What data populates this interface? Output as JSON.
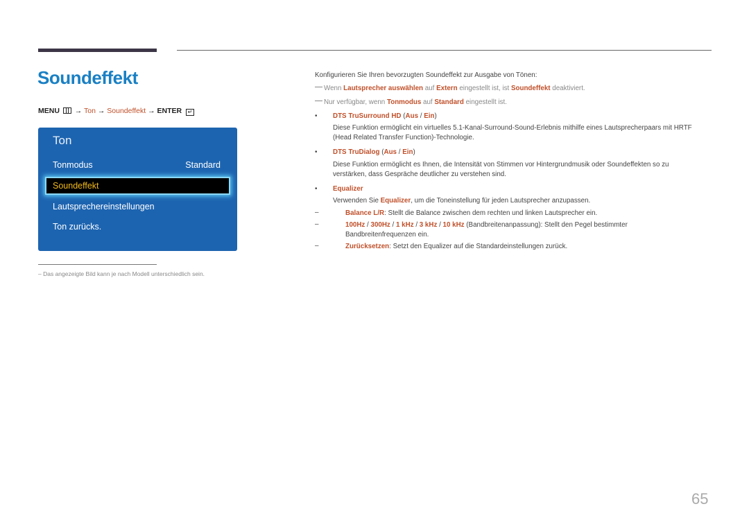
{
  "page": {
    "title": "Soundeffekt",
    "page_number": "65"
  },
  "menu_path": {
    "menu": "MENU",
    "arrow": "→",
    "step1": "Ton",
    "step2": "Soundeffekt",
    "enter": "ENTER",
    "menu_icon": "menu-grid-icon",
    "enter_icon": "enter-return-icon"
  },
  "osd": {
    "title": "Ton",
    "items": [
      {
        "label": "Tonmodus",
        "value": "Standard"
      },
      {
        "label": "Soundeffekt",
        "selected": true
      },
      {
        "label": "Lautsprechereinstellungen"
      },
      {
        "label": "Ton zurücks."
      }
    ],
    "colors": {
      "panel": "#1d64b0",
      "selected_text": "#f2b919",
      "highlight_glow": "#5bc6f0"
    }
  },
  "footnote": "Das angezeigte Bild kann je nach Modell unterschiedlich sein.",
  "content": {
    "intro": "Konfigurieren Sie Ihren bevorzugten Soundeffekt zur Ausgabe von Tönen:",
    "note1": {
      "t1": "Wenn ",
      "k1": "Lautsprecher auswählen",
      "t2": " auf ",
      "k2": "Extern",
      "t3": " eingestellt ist, ist ",
      "k3": "Soundeffekt",
      "t4": " deaktiviert."
    },
    "note2": {
      "t1": "Nur verfügbar, wenn ",
      "k1": "Tonmodus",
      "t2": " auf ",
      "k2": "Standard",
      "t3": " eingestellt ist."
    },
    "bullet1": {
      "name": "DTS TruSurround HD",
      "opt1": "Aus",
      "opt2": "Ein",
      "desc1": "Diese Funktion ermöglicht ein virtuelles 5.1-Kanal-Surround-Sound-Erlebnis mithilfe eines Lautsprecherpaars mit HRTF",
      "desc2": "(Head Related Transfer Function)-Technologie."
    },
    "bullet2": {
      "name": "DTS TruDialog",
      "opt1": "Aus",
      "opt2": "Ein",
      "desc1": "Diese Funktion ermöglicht es Ihnen, die Intensität von Stimmen vor Hintergrundmusik oder Soundeffekten so zu",
      "desc2": "verstärken, dass Gespräche deutlicher zu verstehen sind."
    },
    "bullet3": {
      "name": "Equalizer",
      "desc_t1": "Verwenden Sie ",
      "desc_k1": "Equalizer",
      "desc_t2": ", um die Toneinstellung für jeden Lautsprecher anzupassen.",
      "sub1": {
        "k": "Balance L/R",
        "t": ": Stellt die Balance zwischen dem rechten und linken Lautsprecher ein."
      },
      "sub2": {
        "k1": "100Hz",
        "k2": "300Hz",
        "k3": "1 kHz",
        "k4": "3 kHz",
        "k5": "10 kHz",
        "t1": " (Bandbreitenanpassung): Stellt den Pegel bestimmter",
        "t2": "Bandbreitenfrequenzen ein."
      },
      "sub3": {
        "k": "Zurücksetzen",
        "t": ": Setzt den Equalizer auf die Standardeinstellungen zurück."
      }
    },
    "separator": " / ",
    "bullet_glyph": "•",
    "dash_glyph": "–"
  },
  "colors": {
    "title": "#1a80c4",
    "keyword": "#c0502a",
    "body": "#444444",
    "note": "#888888"
  }
}
